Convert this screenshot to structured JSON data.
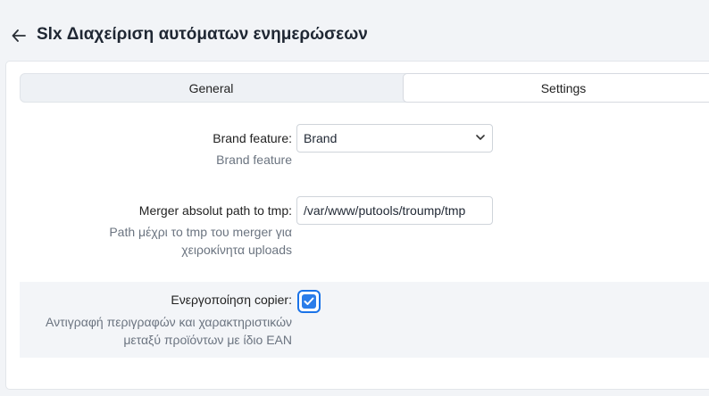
{
  "header": {
    "title": "Slx Διαχείριση αυτόματων ενημερώσεων",
    "back_icon": "arrow-left-icon"
  },
  "tabs": [
    {
      "label": "General",
      "active": false
    },
    {
      "label": "Settings",
      "active": true
    }
  ],
  "settings": {
    "brand_feature": {
      "label": "Brand feature:",
      "value": "Brand",
      "help": "Brand feature"
    },
    "merger_path": {
      "label": "Merger absolut path to tmp:",
      "value": "/var/www/putools/troump/tmp",
      "help_line1": "Path μέχρι το tmp του merger για",
      "help_line2": "χειροκίνητα uploads"
    },
    "copier": {
      "label": "Ενεργοποίηση copier:",
      "checked": true,
      "help_line1": "Αντιγραφή περιγραφών και χαρακτηριστικών",
      "help_line2": "μεταξύ προϊόντων με ίδιο EAN"
    }
  },
  "colors": {
    "accent": "#1a73e8",
    "background": "#f2f4f7"
  }
}
